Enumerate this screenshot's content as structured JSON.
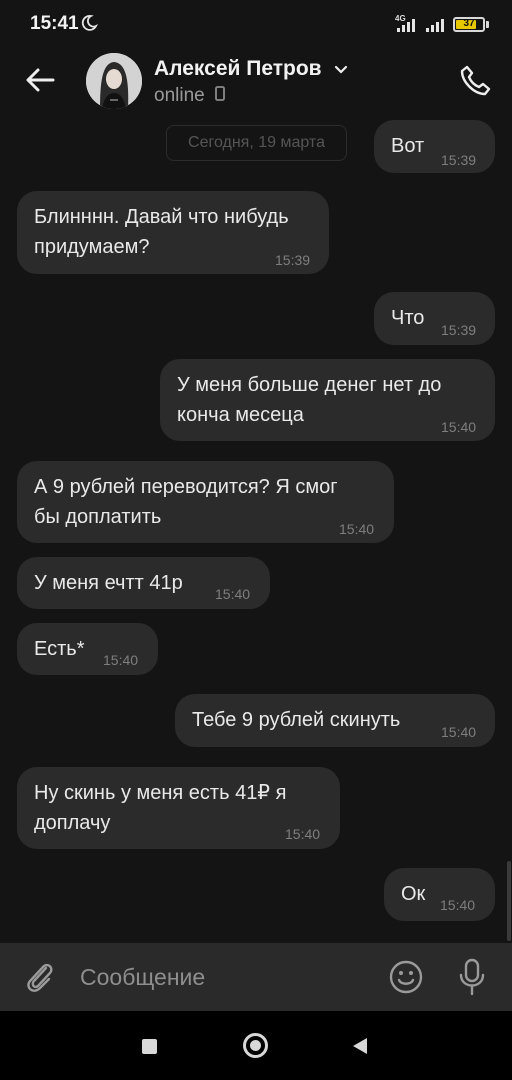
{
  "status_bar": {
    "time": "15:41",
    "network": "4G",
    "battery": "37"
  },
  "header": {
    "contact_name": "Алексей Петров",
    "status": "online"
  },
  "chat": {
    "date_separator": "Сегодня, 19 марта",
    "messages": [
      {
        "side": "out",
        "text": "Вот",
        "time": "15:39"
      },
      {
        "side": "in",
        "text": "Блинннн. Давай что нибудь\nпридумаем?",
        "time": "15:39"
      },
      {
        "side": "out",
        "text": "Что",
        "time": "15:39"
      },
      {
        "side": "out",
        "text": "У меня больше денег нет до\nконча месеца",
        "time": "15:40"
      },
      {
        "side": "in",
        "text": "А 9 рублей переводится? Я смог\nбы доплатить",
        "time": "15:40"
      },
      {
        "side": "in",
        "text": "У меня ечтт 41р",
        "time": "15:40"
      },
      {
        "side": "in",
        "text": "Есть*",
        "time": "15:40"
      },
      {
        "side": "out",
        "text": "Тебе 9 рублей скинуть",
        "time": "15:40"
      },
      {
        "side": "in",
        "text": "Ну скинь у меня есть 41₽ я\nдоплачу",
        "time": "15:40"
      },
      {
        "side": "out",
        "text": "Ок",
        "time": "15:40"
      }
    ]
  },
  "input": {
    "placeholder": "Сообщение",
    "value": ""
  },
  "icons": {
    "back": "arrow-left-icon",
    "phone": "phone-icon",
    "attach": "paperclip-icon",
    "emoji": "smiley-icon",
    "mic": "microphone-icon"
  },
  "colors": {
    "background": "#141414",
    "bubble": "#2b2b2b",
    "input_bar": "#2a2a2a",
    "battery": "#e7c800"
  }
}
